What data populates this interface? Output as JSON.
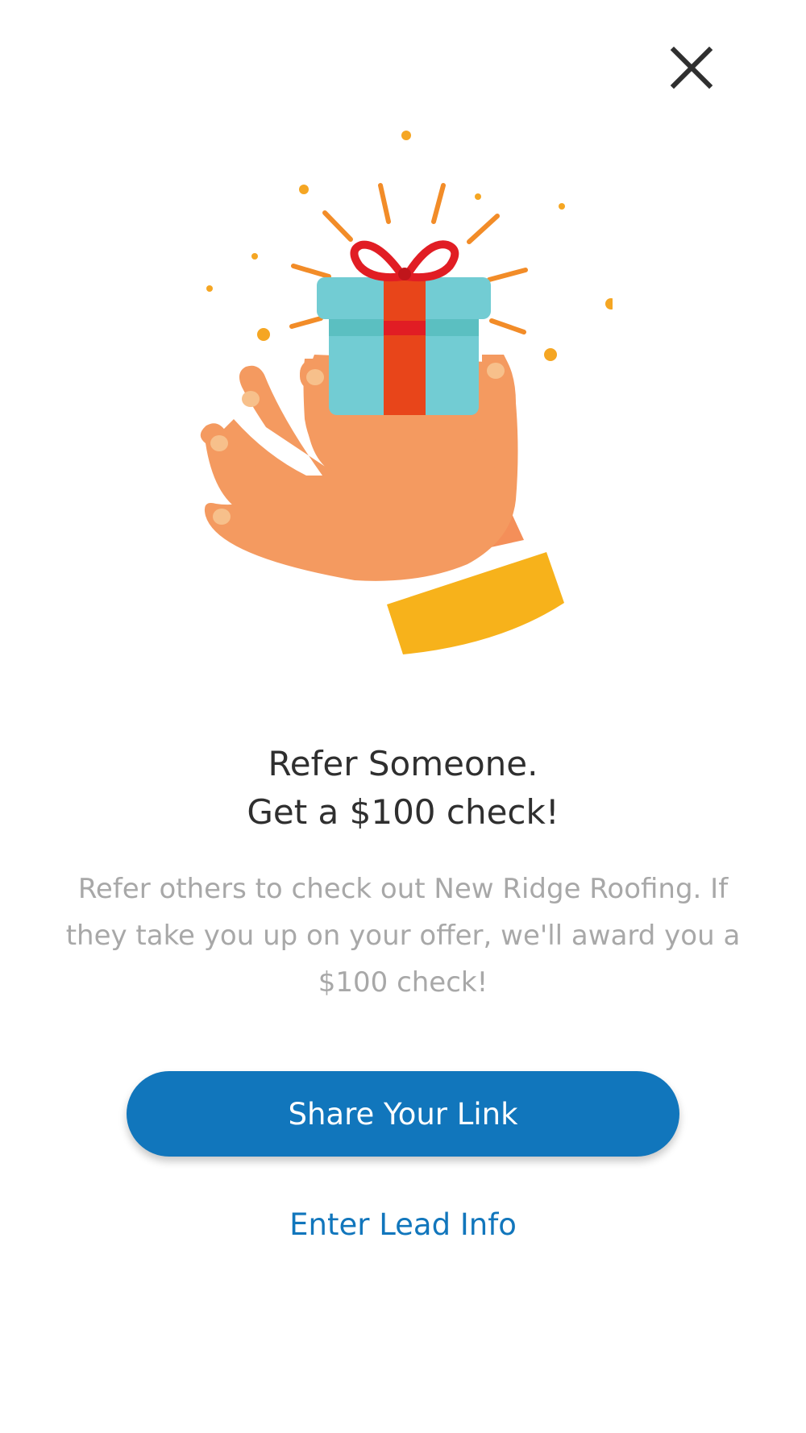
{
  "icons": {
    "close": "close-icon",
    "hero": "gift-in-hand-illustration"
  },
  "colors": {
    "primary": "#1176bc",
    "title": "#2f2f2f",
    "body_text": "#a8a8a8"
  },
  "referral": {
    "title_line1": "Refer Someone.",
    "title_line2": "Get a $100 check!",
    "description": "Refer others to check out New Ridge Roofing. If they take you up on your offer, we'll award you a $100 check!",
    "share_button_label": "Share Your Link",
    "lead_link_label": "Enter Lead Info"
  }
}
